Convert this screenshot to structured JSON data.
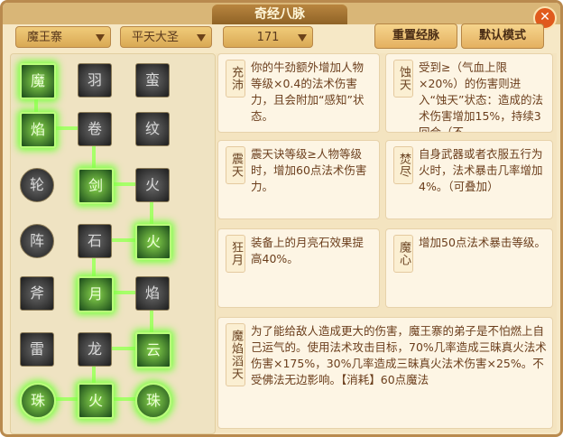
{
  "title": "奇经八脉",
  "filters": {
    "school": "魔王寨",
    "style": "平天大圣",
    "points": "171"
  },
  "buttons": {
    "reset": "重置经脉",
    "default": "默认模式"
  },
  "tiles": {
    "row0": [
      "魔",
      "羽",
      "蛮"
    ],
    "row1": [
      "焰",
      "卷",
      "纹"
    ],
    "row2": [
      "轮",
      "剑",
      "火"
    ],
    "row3": [
      "阵",
      "石",
      "火"
    ],
    "row4": [
      "斧",
      "月",
      "焰"
    ],
    "row5": [
      "雷",
      "龙",
      "云"
    ],
    "row6": [
      "珠",
      "火",
      "珠"
    ]
  },
  "cards": [
    {
      "label": "充沛",
      "desc": "你的牛劲额外增加人物等级×0.4的法术伤害力，且会附加“感知”状态。"
    },
    {
      "label": "蚀天",
      "desc": "受到≥（气血上限×20%）的伤害则进入“蚀天”状态：造成的法术伤害增加15%，持续3回合（不…"
    },
    {
      "label": "震天",
      "desc": "震天诀等级≥人物等级时，增加60点法术伤害力。"
    },
    {
      "label": "焚尽",
      "desc": "自身武器或者衣服五行为火时，法术暴击几率增加4%。（可叠加）"
    },
    {
      "label": "狂月",
      "desc": "装备上的月亮石效果提高40%。"
    },
    {
      "label": "魔心",
      "desc": "增加50点法术暴击等级。"
    },
    {
      "label": "魔焰滔天",
      "desc": "为了能给敌人造成更大的伤害，魔王寨的弟子是不怕燃上自己运气的。使用法术攻击目标，70%几率造成三昧真火法术伤害×175%，30%几率造成三昧真火法术伤害×25%。不受佛法无边影响。【消耗】60点魔法"
    }
  ]
}
